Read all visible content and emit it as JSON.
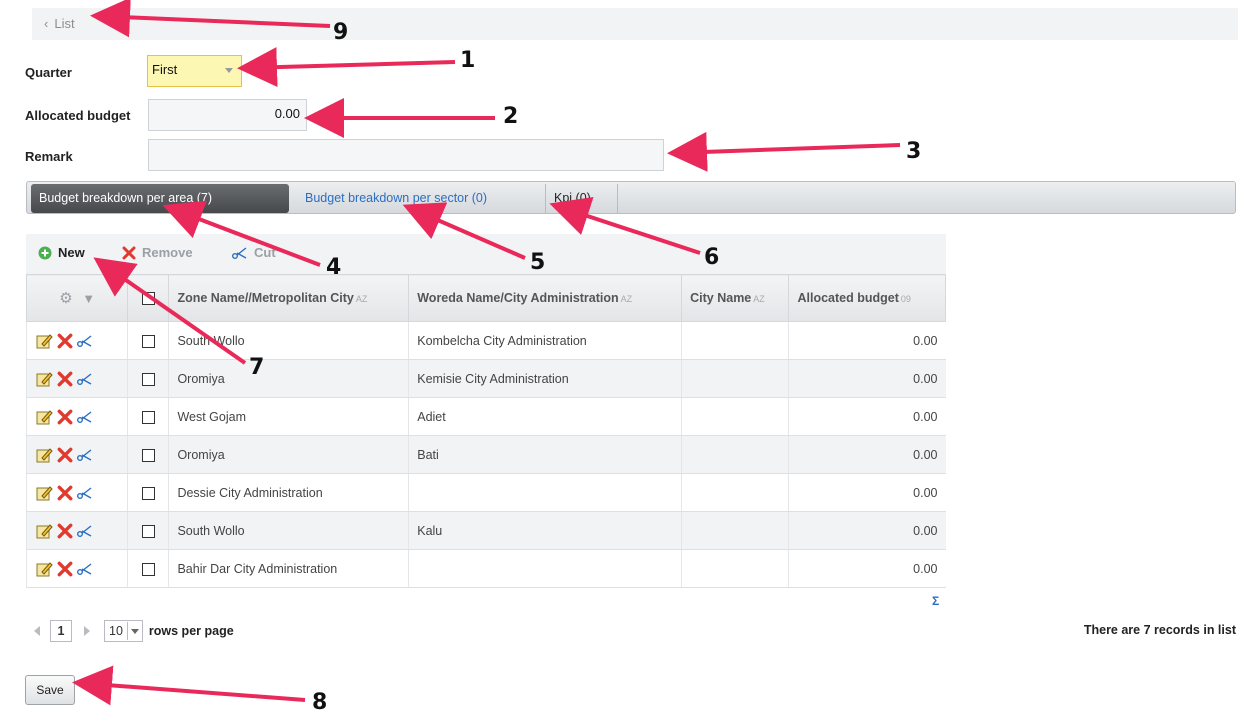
{
  "header": {
    "back_label": "List"
  },
  "form": {
    "quarter_label": "Quarter",
    "quarter_value": "First",
    "budget_label": "Allocated budget",
    "budget_value": "0.00",
    "remark_label": "Remark",
    "remark_value": ""
  },
  "tabs": [
    {
      "label": "Budget breakdown per area (7)"
    },
    {
      "label": "Budget breakdown per sector (0)"
    },
    {
      "label": "Kpi (0)"
    }
  ],
  "toolbar": {
    "new_label": "New",
    "remove_label": "Remove",
    "cut_label": "Cut"
  },
  "table": {
    "columns": [
      "Zone Name//Metropolitan City",
      "Woreda Name/City Administration",
      "City Name",
      "Allocated budget"
    ],
    "rows": [
      {
        "zone": "South Wollo",
        "woreda": "Kombelcha City Administration",
        "city": "",
        "budget": "0.00"
      },
      {
        "zone": "Oromiya",
        "woreda": "Kemisie City Administration",
        "city": "",
        "budget": "0.00"
      },
      {
        "zone": "West Gojam",
        "woreda": "Adiet",
        "city": "",
        "budget": "0.00"
      },
      {
        "zone": "Oromiya",
        "woreda": "Bati",
        "city": "",
        "budget": "0.00"
      },
      {
        "zone": "Dessie City Administration",
        "woreda": "",
        "city": "",
        "budget": "0.00"
      },
      {
        "zone": "South Wollo",
        "woreda": "Kalu",
        "city": "",
        "budget": "0.00"
      },
      {
        "zone": "Bahir Dar City Administration",
        "woreda": "",
        "city": "",
        "budget": "0.00"
      }
    ],
    "sum_symbol": "Σ"
  },
  "pager": {
    "page": "1",
    "rows_per_page": "10",
    "rows_label": "rows per page",
    "records_text": "There are 7 records in list"
  },
  "footer": {
    "save_label": "Save"
  },
  "annotations": [
    "1",
    "2",
    "3",
    "4",
    "5",
    "6",
    "7",
    "8",
    "9"
  ],
  "colors": {
    "arrow": "#e8295a",
    "accent_link": "#2b6fc2",
    "quarter_highlight": "#fdf7b4"
  }
}
